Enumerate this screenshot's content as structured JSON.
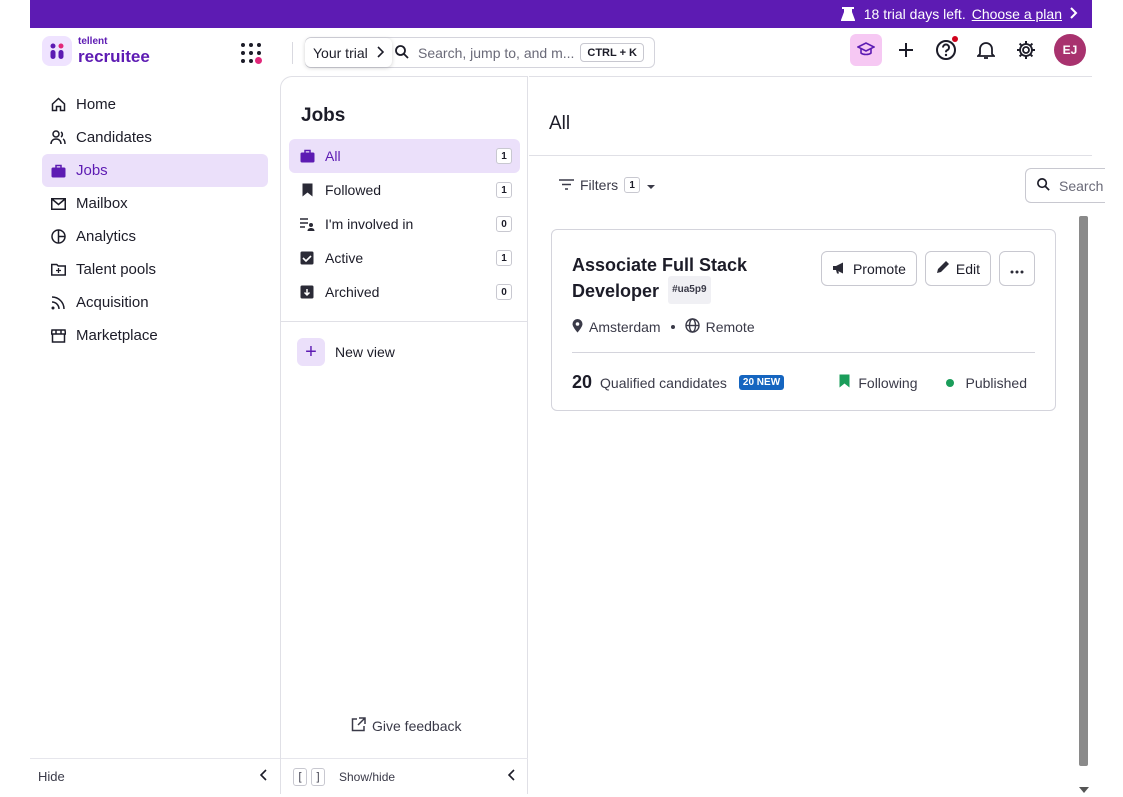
{
  "trial_banner": {
    "text": "18 trial days left.",
    "link": "Choose a plan",
    "bg_color": "#5d1bb3"
  },
  "header": {
    "logo_small": "tellent",
    "logo_big": "recruitee",
    "trial_chip": "Your trial",
    "search_placeholder": "Search, jump to, and m...",
    "shortcut": "CTRL + K",
    "avatar_initials": "EJ"
  },
  "sidebar": {
    "items": [
      {
        "label": "Home",
        "icon": "home-icon"
      },
      {
        "label": "Candidates",
        "icon": "users-icon"
      },
      {
        "label": "Jobs",
        "icon": "briefcase-icon",
        "active": true
      },
      {
        "label": "Mailbox",
        "icon": "mail-icon"
      },
      {
        "label": "Analytics",
        "icon": "pie-chart-icon"
      },
      {
        "label": "Talent pools",
        "icon": "folder-icon"
      },
      {
        "label": "Acquisition",
        "icon": "rss-icon"
      },
      {
        "label": "Marketplace",
        "icon": "store-icon"
      }
    ],
    "hide_label": "Hide",
    "accent_color": "#5d1bb3"
  },
  "jobs_panel": {
    "title": "Jobs",
    "views": [
      {
        "label": "All",
        "count": "1",
        "icon": "briefcase-icon",
        "active": true
      },
      {
        "label": "Followed",
        "count": "1",
        "icon": "bookmark-icon"
      },
      {
        "label": "I'm involved in",
        "count": "0",
        "icon": "team-list-icon"
      },
      {
        "label": "Active",
        "count": "1",
        "icon": "active-box-icon"
      },
      {
        "label": "Archived",
        "count": "0",
        "icon": "archive-icon"
      }
    ],
    "new_view": "New view",
    "feedback": "Give feedback",
    "show_hide": "Show/hide"
  },
  "main": {
    "title": "All",
    "filters_label": "Filters",
    "filters_count": "1",
    "search_placeholder": "Search",
    "job": {
      "title": "Associate Full Stack Developer",
      "code": "#ua5p9",
      "location": "Amsterdam",
      "remote": "Remote",
      "qualified_count": "20",
      "qualified_label": "Qualified candidates",
      "new_badge": "20 NEW",
      "following": "Following",
      "status": "Published",
      "actions": {
        "promote": "Promote",
        "edit": "Edit"
      }
    }
  }
}
